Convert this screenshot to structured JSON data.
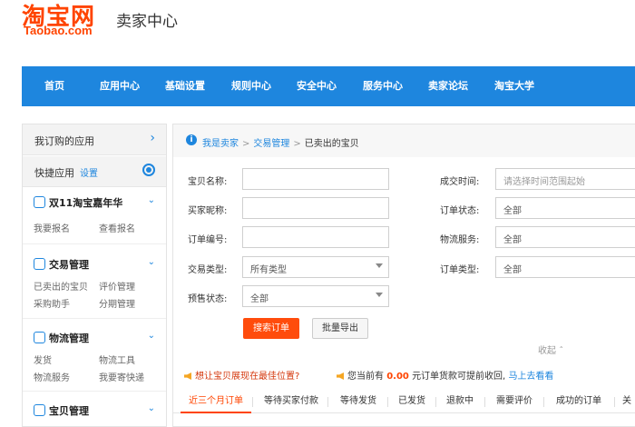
{
  "header": {
    "logo_cn": "淘宝网",
    "logo_en": "Taobao.com",
    "title": "卖家中心",
    "brand_color": "#ff4400"
  },
  "nav": {
    "color": "#1e86de",
    "items": [
      "首页",
      "应用中心",
      "基础设置",
      "规则中心",
      "安全中心",
      "服务中心",
      "卖家论坛",
      "淘宝大学"
    ]
  },
  "sidebar": {
    "my_apps": "我订购的应用",
    "quick_apps": "快捷应用",
    "quick_settings": "设置",
    "sections": [
      {
        "title": "双11淘宝嘉年华",
        "icon": "festival-icon",
        "links": [
          "我要报名",
          "查看报名"
        ]
      },
      {
        "title": "交易管理",
        "icon": "trade-icon",
        "links": [
          "已卖出的宝贝",
          "评价管理",
          "采购助手",
          "分期管理"
        ]
      },
      {
        "title": "物流管理",
        "icon": "truck-icon",
        "links": [
          "发货",
          "物流工具",
          "物流服务",
          "我要寄快递"
        ]
      },
      {
        "title": "宝贝管理",
        "icon": "shirt-icon",
        "links": []
      }
    ]
  },
  "breadcrumb": {
    "items": [
      "我是卖家",
      "交易管理",
      "已卖出的宝贝"
    ],
    "separator": ">"
  },
  "form": {
    "item_name_label": "宝贝名称:",
    "buyer_nick_label": "买家昵称:",
    "order_no_label": "订单编号:",
    "trade_type_label": "交易类型:",
    "trade_type_value": "所有类型",
    "presale_label": "预售状态:",
    "presale_value": "全部",
    "deal_time_label": "成交时间:",
    "deal_time_placeholder": "请选择时间范围起始",
    "order_status_label": "订单状态:",
    "order_status_value": "全部",
    "logistics_label": "物流服务:",
    "logistics_value": "全部",
    "order_type_label": "订单类型:",
    "order_type_value": "全部",
    "search_button": "搜索订单",
    "export_button": "批量导出",
    "collapse": "收起"
  },
  "notices": {
    "promo": "想让宝贝展现在最佳位置?",
    "payment_prefix": "您当前有",
    "payment_amount": "0.00",
    "payment_suffix": "元订单货款可提前收回,",
    "payment_link": "马上去看看"
  },
  "tabs": {
    "items": [
      "近三个月订单",
      "等待买家付款",
      "等待发货",
      "已发货",
      "退款中",
      "需要评价",
      "成功的订单",
      "关"
    ],
    "active": 0
  }
}
